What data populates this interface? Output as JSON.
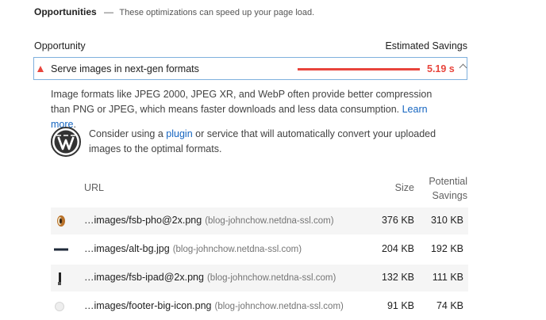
{
  "section": {
    "title": "Opportunities",
    "separator": "—",
    "description": "These optimizations can speed up your page load."
  },
  "columns": {
    "opportunity": "Opportunity",
    "estimated_savings": "Estimated Savings"
  },
  "audit": {
    "title": "Serve images in next-gen formats",
    "savings": "5.19 s",
    "status_color": "#e8453c",
    "description_text": "Image formats like JPEG 2000, JPEG XR, and WebP often provide better compression than PNG or JPEG, which means faster downloads and less data consumption.",
    "learn_more": "Learn more",
    "learn_more_suffix": ".",
    "tip_prefix": "Consider using a",
    "tip_link": "plugin",
    "tip_suffix": "or service that will automatically convert your uploaded images to the optimal formats.",
    "tip_icon": "wordpress-logo-icon"
  },
  "table": {
    "headers": {
      "url": "URL",
      "size": "Size",
      "potential_line1": "Potential",
      "potential_line2": "Savings"
    },
    "rows": [
      {
        "path": "…images/fsb-pho@2x.png",
        "host": "(blog-johnchow.netdna-ssl.com)",
        "size": "376 KB",
        "savings": "310 KB",
        "thumb": "photo-thumbnail"
      },
      {
        "path": "…images/alt-bg.jpg",
        "host": "(blog-johnchow.netdna-ssl.com)",
        "size": "204 KB",
        "savings": "192 KB",
        "thumb": "bar-thumbnail"
      },
      {
        "path": "…images/fsb-ipad@2x.png",
        "host": "(blog-johnchow.netdna-ssl.com)",
        "size": "132 KB",
        "savings": "111 KB",
        "thumb": "ipad-thumbnail"
      },
      {
        "path": "…images/footer-big-icon.png",
        "host": "(blog-johnchow.netdna-ssl.com)",
        "size": "91 KB",
        "savings": "74 KB",
        "thumb": "icon-thumbnail"
      }
    ]
  }
}
